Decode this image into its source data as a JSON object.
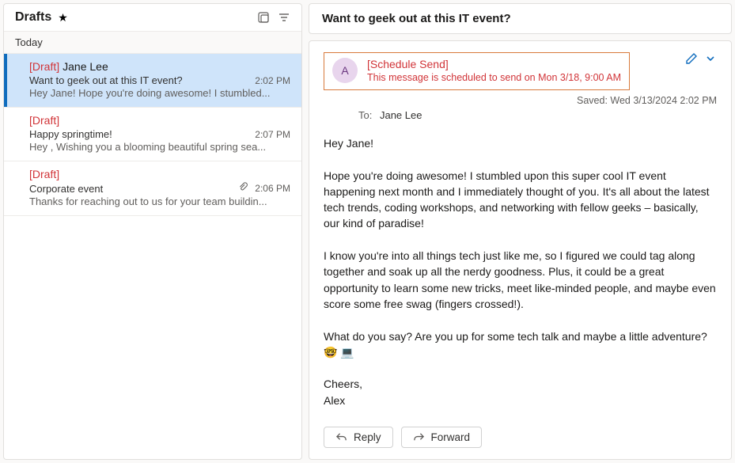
{
  "folder": {
    "name": "Drafts"
  },
  "section_label": "Today",
  "drafts": [
    {
      "draft_label": "[Draft]",
      "from": "Jane Lee",
      "subject": "Want to geek out at this IT event?",
      "time": "2:02 PM",
      "preview": "Hey Jane! Hope you're doing awesome! I stumbled...",
      "selected": true,
      "has_attachment": false
    },
    {
      "draft_label": "[Draft]",
      "from": "",
      "subject": "Happy springtime!",
      "time": "2:07 PM",
      "preview": "Hey , Wishing you a blooming beautiful spring sea...",
      "selected": false,
      "has_attachment": false
    },
    {
      "draft_label": "[Draft]",
      "from": "",
      "subject": "Corporate event",
      "time": "2:06 PM",
      "preview": "Thanks for reaching out to us for your team buildin...",
      "selected": false,
      "has_attachment": true
    }
  ],
  "reading": {
    "subject": "Want to geek out at this IT event?",
    "avatar_initial": "A",
    "schedule_title": "[Schedule Send]",
    "schedule_note": "This message is scheduled to send on Mon 3/18, 9:00 AM",
    "saved_label": "Saved: Wed 3/13/2024 2:02 PM",
    "to_label": "To:",
    "to_value": "Jane Lee",
    "body": "Hey Jane!\n\nHope you're doing awesome! I stumbled upon this super cool IT event happening next month and I immediately thought of you. It's all about the latest tech trends, coding workshops, and networking with fellow geeks – basically, our kind of paradise!\n\nI know you're into all things tech just like me, so I figured we could tag along together and soak up all the nerdy goodness. Plus, it could be a great opportunity to learn some new tricks, meet like-minded people, and maybe even score some free swag (fingers crossed!).\n\nWhat do you say? Are you up for some tech talk and maybe a little adventure? 🤓 💻\n\nCheers,\nAlex",
    "reply_label": "Reply",
    "forward_label": "Forward"
  }
}
